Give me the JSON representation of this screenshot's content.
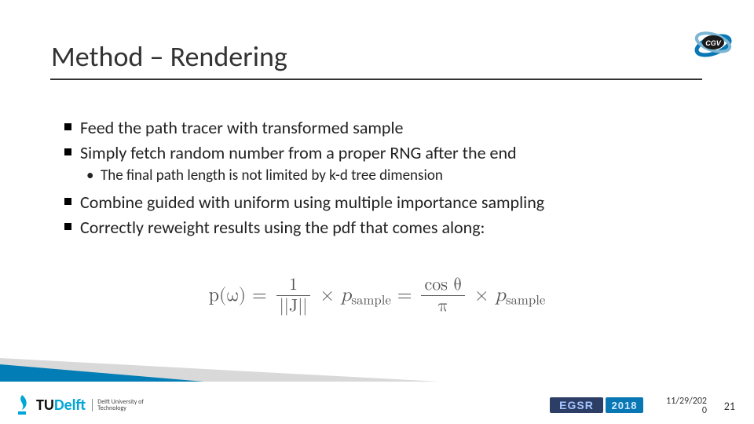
{
  "title": "Method – Rendering",
  "bullets": {
    "b1": "Feed the path tracer with transformed sample",
    "b2": "Simply fetch random number from a proper RNG after the end",
    "b2a": "The final path length is not limited by k-d tree dimension",
    "b3": "Combine guided with uniform using multiple importance sampling",
    "b4": "Correctly reweight results using the pdf that comes along:"
  },
  "formula": {
    "lhs": "p(ω)",
    "eq": " = ",
    "f1_num": "1",
    "f1_den": "||J||",
    "times": " × ",
    "psample": "p",
    "psample_sub": "sample",
    "eq2": " = ",
    "f2_num": "cos θ",
    "f2_den": "π"
  },
  "logos": {
    "cgv": "CGV",
    "tu": "TU",
    "delft": "Delft",
    "tud_sub1": "Delft University of",
    "tud_sub2": "Technology",
    "egsr": "EGSR",
    "egsr_year": "2018"
  },
  "footer": {
    "date_line1": "11/29/202",
    "date_line2": "0",
    "page": "21"
  }
}
